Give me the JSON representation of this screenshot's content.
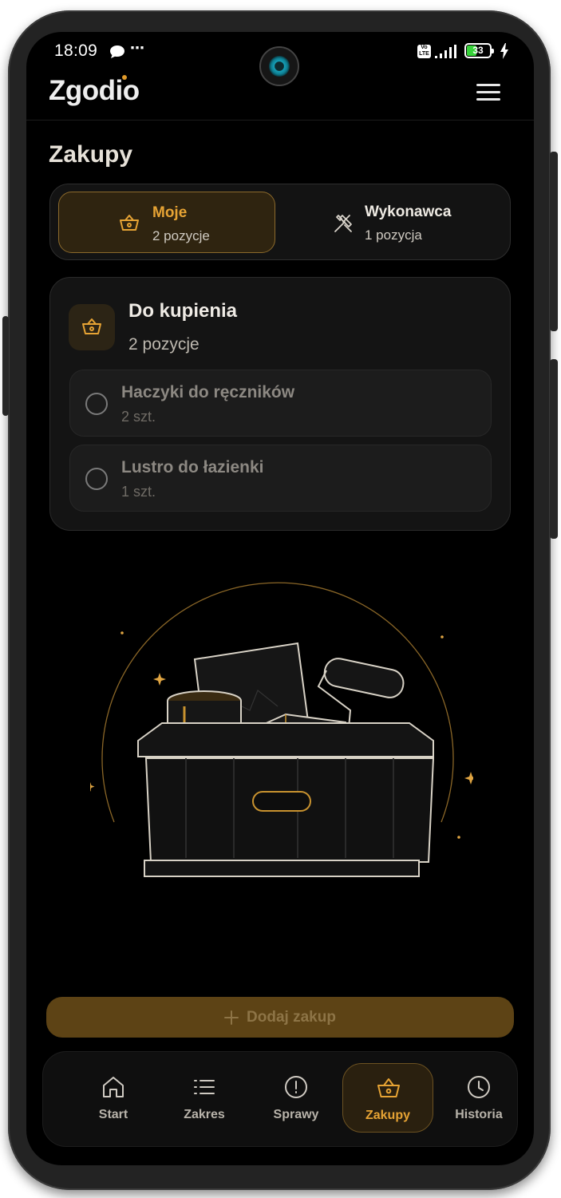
{
  "status_bar": {
    "time": "18:09",
    "battery": "33",
    "volte": "Vo LTE"
  },
  "app": {
    "brand": "Zgodio"
  },
  "page": {
    "title": "Zakupy"
  },
  "segments": [
    {
      "label": "Moje",
      "count": "2 pozycje",
      "active": true
    },
    {
      "label": "Wykonawca",
      "count": "1 pozycja",
      "active": false
    }
  ],
  "list_card": {
    "title": "Do kupienia",
    "count": "2 pozycje",
    "items": [
      {
        "name": "Haczyki do ręczników",
        "qty": "2 szt."
      },
      {
        "name": "Lustro do łazienki",
        "qty": "1 szt."
      }
    ]
  },
  "add_button": {
    "label": "Dodaj zakup"
  },
  "bottom_nav": [
    {
      "label": "Start",
      "icon": "home-icon"
    },
    {
      "label": "Zakres",
      "icon": "list-icon"
    },
    {
      "label": "Sprawy",
      "icon": "alert-circle-icon"
    },
    {
      "label": "Zakupy",
      "icon": "basket-icon",
      "active": true
    },
    {
      "label": "Historia",
      "icon": "clock-icon"
    }
  ],
  "colors": {
    "accent": "#e6a334",
    "background": "#000000",
    "card": "#141414"
  }
}
